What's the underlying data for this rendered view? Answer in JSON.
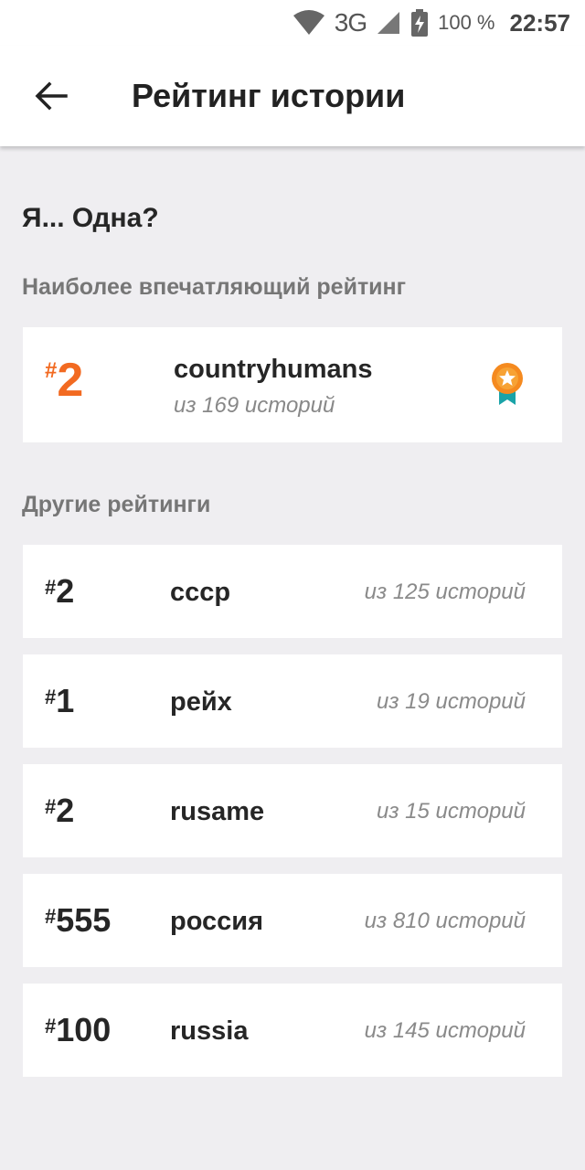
{
  "status_bar": {
    "network": "3G",
    "battery_percent": "100 %",
    "time": "22:57"
  },
  "app_bar": {
    "title": "Рейтинг истории",
    "back_icon": "arrow-left-icon"
  },
  "story": {
    "title": "Я... Одна?"
  },
  "featured_section": {
    "label": "Наиболее впечатляющий рейтинг",
    "item": {
      "hash": "#",
      "rank": "2",
      "tag": "countryhumans",
      "count_text": "из 169 историй",
      "badge_icon": "award-ribbon-icon"
    }
  },
  "other_section": {
    "label": "Другие рейтинги",
    "items": [
      {
        "hash": "#",
        "rank": "2",
        "tag": "ссср",
        "count_text": "из 125 историй"
      },
      {
        "hash": "#",
        "rank": "1",
        "tag": "рейх",
        "count_text": "из 19 историй"
      },
      {
        "hash": "#",
        "rank": "2",
        "tag": "rusame",
        "count_text": "из 15 историй"
      },
      {
        "hash": "#",
        "rank": "555",
        "tag": "россия",
        "count_text": "из 810 историй"
      },
      {
        "hash": "#",
        "rank": "100",
        "tag": "russia",
        "count_text": "из 145 историй"
      }
    ]
  },
  "colors": {
    "accent": "#f26a21",
    "badge_ribbon": "#1aa3a8",
    "background": "#efeef1",
    "card": "#ffffff"
  }
}
